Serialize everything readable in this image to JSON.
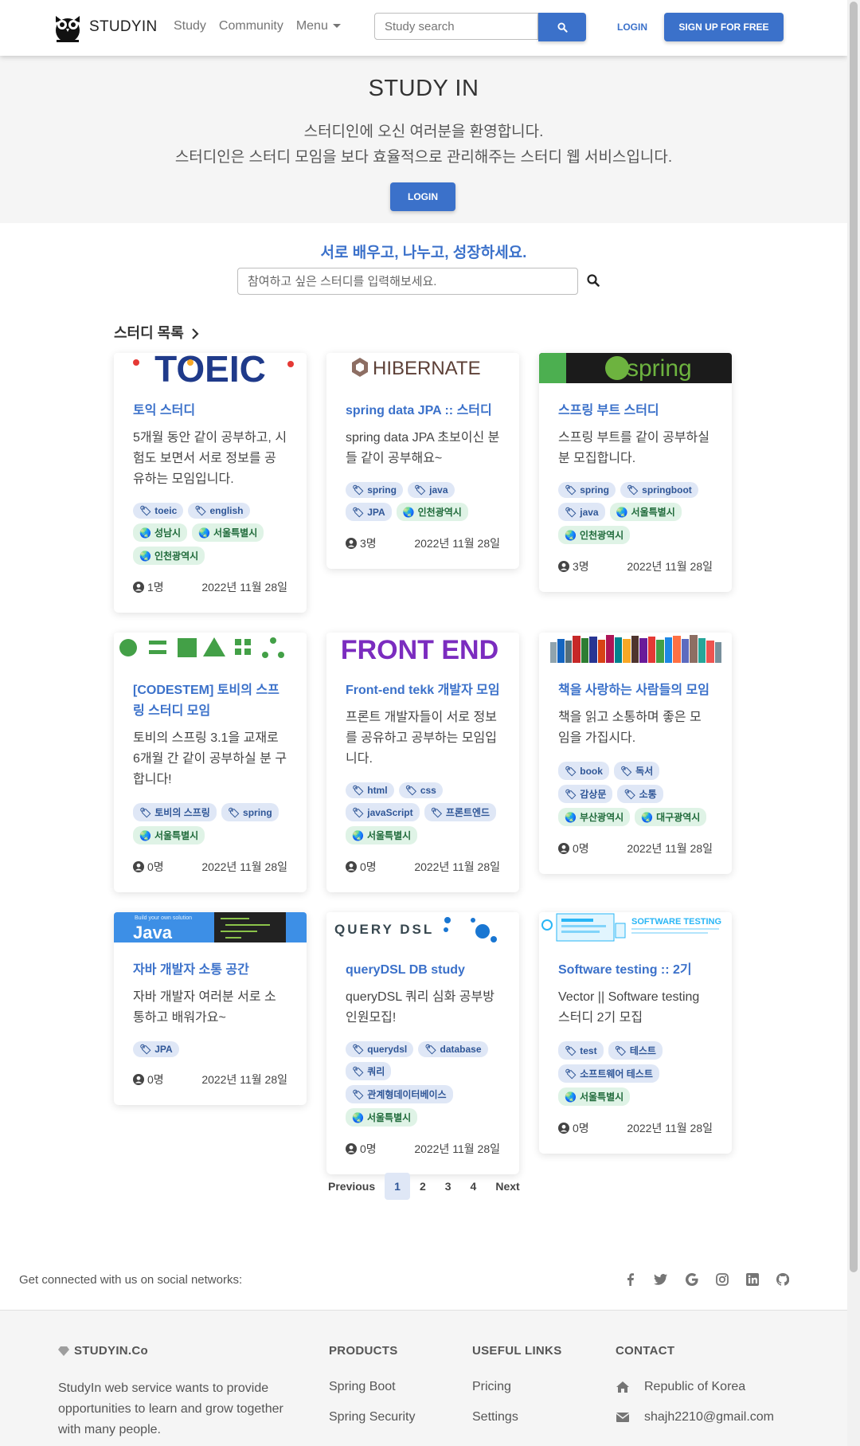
{
  "nav": {
    "brand": "STUDYIN",
    "links": [
      "Study",
      "Community"
    ],
    "menu_label": "Menu",
    "search_placeholder": "Study search",
    "login": "LOGIN",
    "signup": "SIGN UP FOR FREE"
  },
  "hero": {
    "title": "STUDY IN",
    "line1": "스터디인에 오신 여러분을 환영합니다.",
    "line2": "스터디인은 스터디 모임을 보다 효율적으로 관리해주는 스터디 웹 서비스입니다.",
    "button": "LOGIN"
  },
  "tagline": "서로 배우고, 나누고, 성장하세요.",
  "main_search_placeholder": "참여하고 싶은 스터디를 입력해보세요.",
  "section_title": "스터디 목록",
  "cards": [
    {
      "banner": "TOEIC",
      "title": "토익 스터디",
      "desc": "5개월 동안 같이 공부하고, 시험도 보면서 서로 정보를 공유하는 모임입니다.",
      "tags": [
        "toeic",
        "english"
      ],
      "regions": [
        "성남시",
        "서울특별시",
        "인천광역시"
      ],
      "members": "1명",
      "date": "2022년 11월 28일"
    },
    {
      "banner": "HIBERNATE",
      "title": "spring data JPA :: 스터디",
      "desc": "spring data JPA 초보이신 분들 같이 공부해요~",
      "tags": [
        "spring",
        "java",
        "JPA"
      ],
      "regions": [
        "인천광역시"
      ],
      "members": "3명",
      "date": "2022년 11월 28일"
    },
    {
      "banner": "spring",
      "title": "스프링 부트 스터디",
      "desc": "스프링 부트를 같이 공부하실 분 모집합니다.",
      "tags": [
        "spring",
        "springboot",
        "java"
      ],
      "regions": [
        "서울특별시",
        "인천광역시"
      ],
      "members": "3명",
      "date": "2022년 11월 28일"
    },
    {
      "banner": "",
      "title": "[CODESTEM] 토비의 스프링 스터디 모임",
      "desc": "토비의 스프링 3.1을 교재로 6개월 간 같이 공부하실 분 구합니다!",
      "tags": [
        "토비의 스프링",
        "spring"
      ],
      "regions": [
        "서울특별시"
      ],
      "members": "0명",
      "date": "2022년 11월 28일"
    },
    {
      "banner": "FRONT END",
      "title": "Front-end tekk 개발자 모임",
      "desc": "프론트 개발자들이 서로 정보를 공유하고 공부하는 모임입니다.",
      "tags": [
        "html",
        "css",
        "javaScript",
        "프론트엔드"
      ],
      "regions": [
        "서울특별시"
      ],
      "members": "0명",
      "date": "2022년 11월 28일"
    },
    {
      "banner": "",
      "title": "책을 사랑하는 사람들의 모임",
      "desc": "책을 읽고 소통하며 좋은 모임을 가집시다.",
      "tags": [
        "book",
        "독서",
        "감상문",
        "소통"
      ],
      "regions": [
        "부산광역시",
        "대구광역시"
      ],
      "members": "0명",
      "date": "2022년 11월 28일"
    },
    {
      "banner": "Java",
      "banner_sub": "Build your own solution",
      "title": "자바 개발자 소통 공간",
      "desc": "자바 개발자 여러분 서로 소통하고 배워가요~",
      "tags": [
        "JPA"
      ],
      "regions": [],
      "members": "0명",
      "date": "2022년 11월 28일"
    },
    {
      "banner": "QUERY DSL",
      "title": "queryDSL DB study",
      "desc": "queryDSL 쿼리 심화 공부방 인원모집!",
      "tags": [
        "querydsl",
        "database",
        "쿼리",
        "관계형데이터베이스"
      ],
      "regions": [
        "서울특별시"
      ],
      "members": "0명",
      "date": "2022년 11월 28일"
    },
    {
      "banner": "SOFTWARE TESTING",
      "title": "Software testing :: 2기",
      "desc": "Vector || Software testing 스터디 2기 모집",
      "tags": [
        "test",
        "테스트",
        "소프트웨어 테스트"
      ],
      "regions": [
        "서울특별시"
      ],
      "members": "0명",
      "date": "2022년 11월 28일"
    }
  ],
  "pagination": {
    "prev": "Previous",
    "pages": [
      "1",
      "2",
      "3",
      "4"
    ],
    "active": "1",
    "next": "Next"
  },
  "social": {
    "text": "Get connected with us on social networks:",
    "icons": [
      "facebook-icon",
      "twitter-icon",
      "google-icon",
      "instagram-icon",
      "linkedin-icon",
      "github-icon"
    ]
  },
  "footer": {
    "company": "STUDYIN.Co",
    "company_desc": "StudyIn web service wants to provide opportunities to learn and grow together with many people.",
    "products_head": "PRODUCTS",
    "products": [
      "Spring Boot",
      "Spring Security"
    ],
    "links_head": "USEFUL LINKS",
    "links": [
      "Pricing",
      "Settings"
    ],
    "contact_head": "CONTACT",
    "contact": [
      "Republic of Korea",
      "shajh2210@gmail.com"
    ]
  },
  "colors": {
    "primary": "#3b71ca",
    "tag_blue_bg": "#dfe7f6",
    "tag_green_bg": "#dff3e6"
  }
}
